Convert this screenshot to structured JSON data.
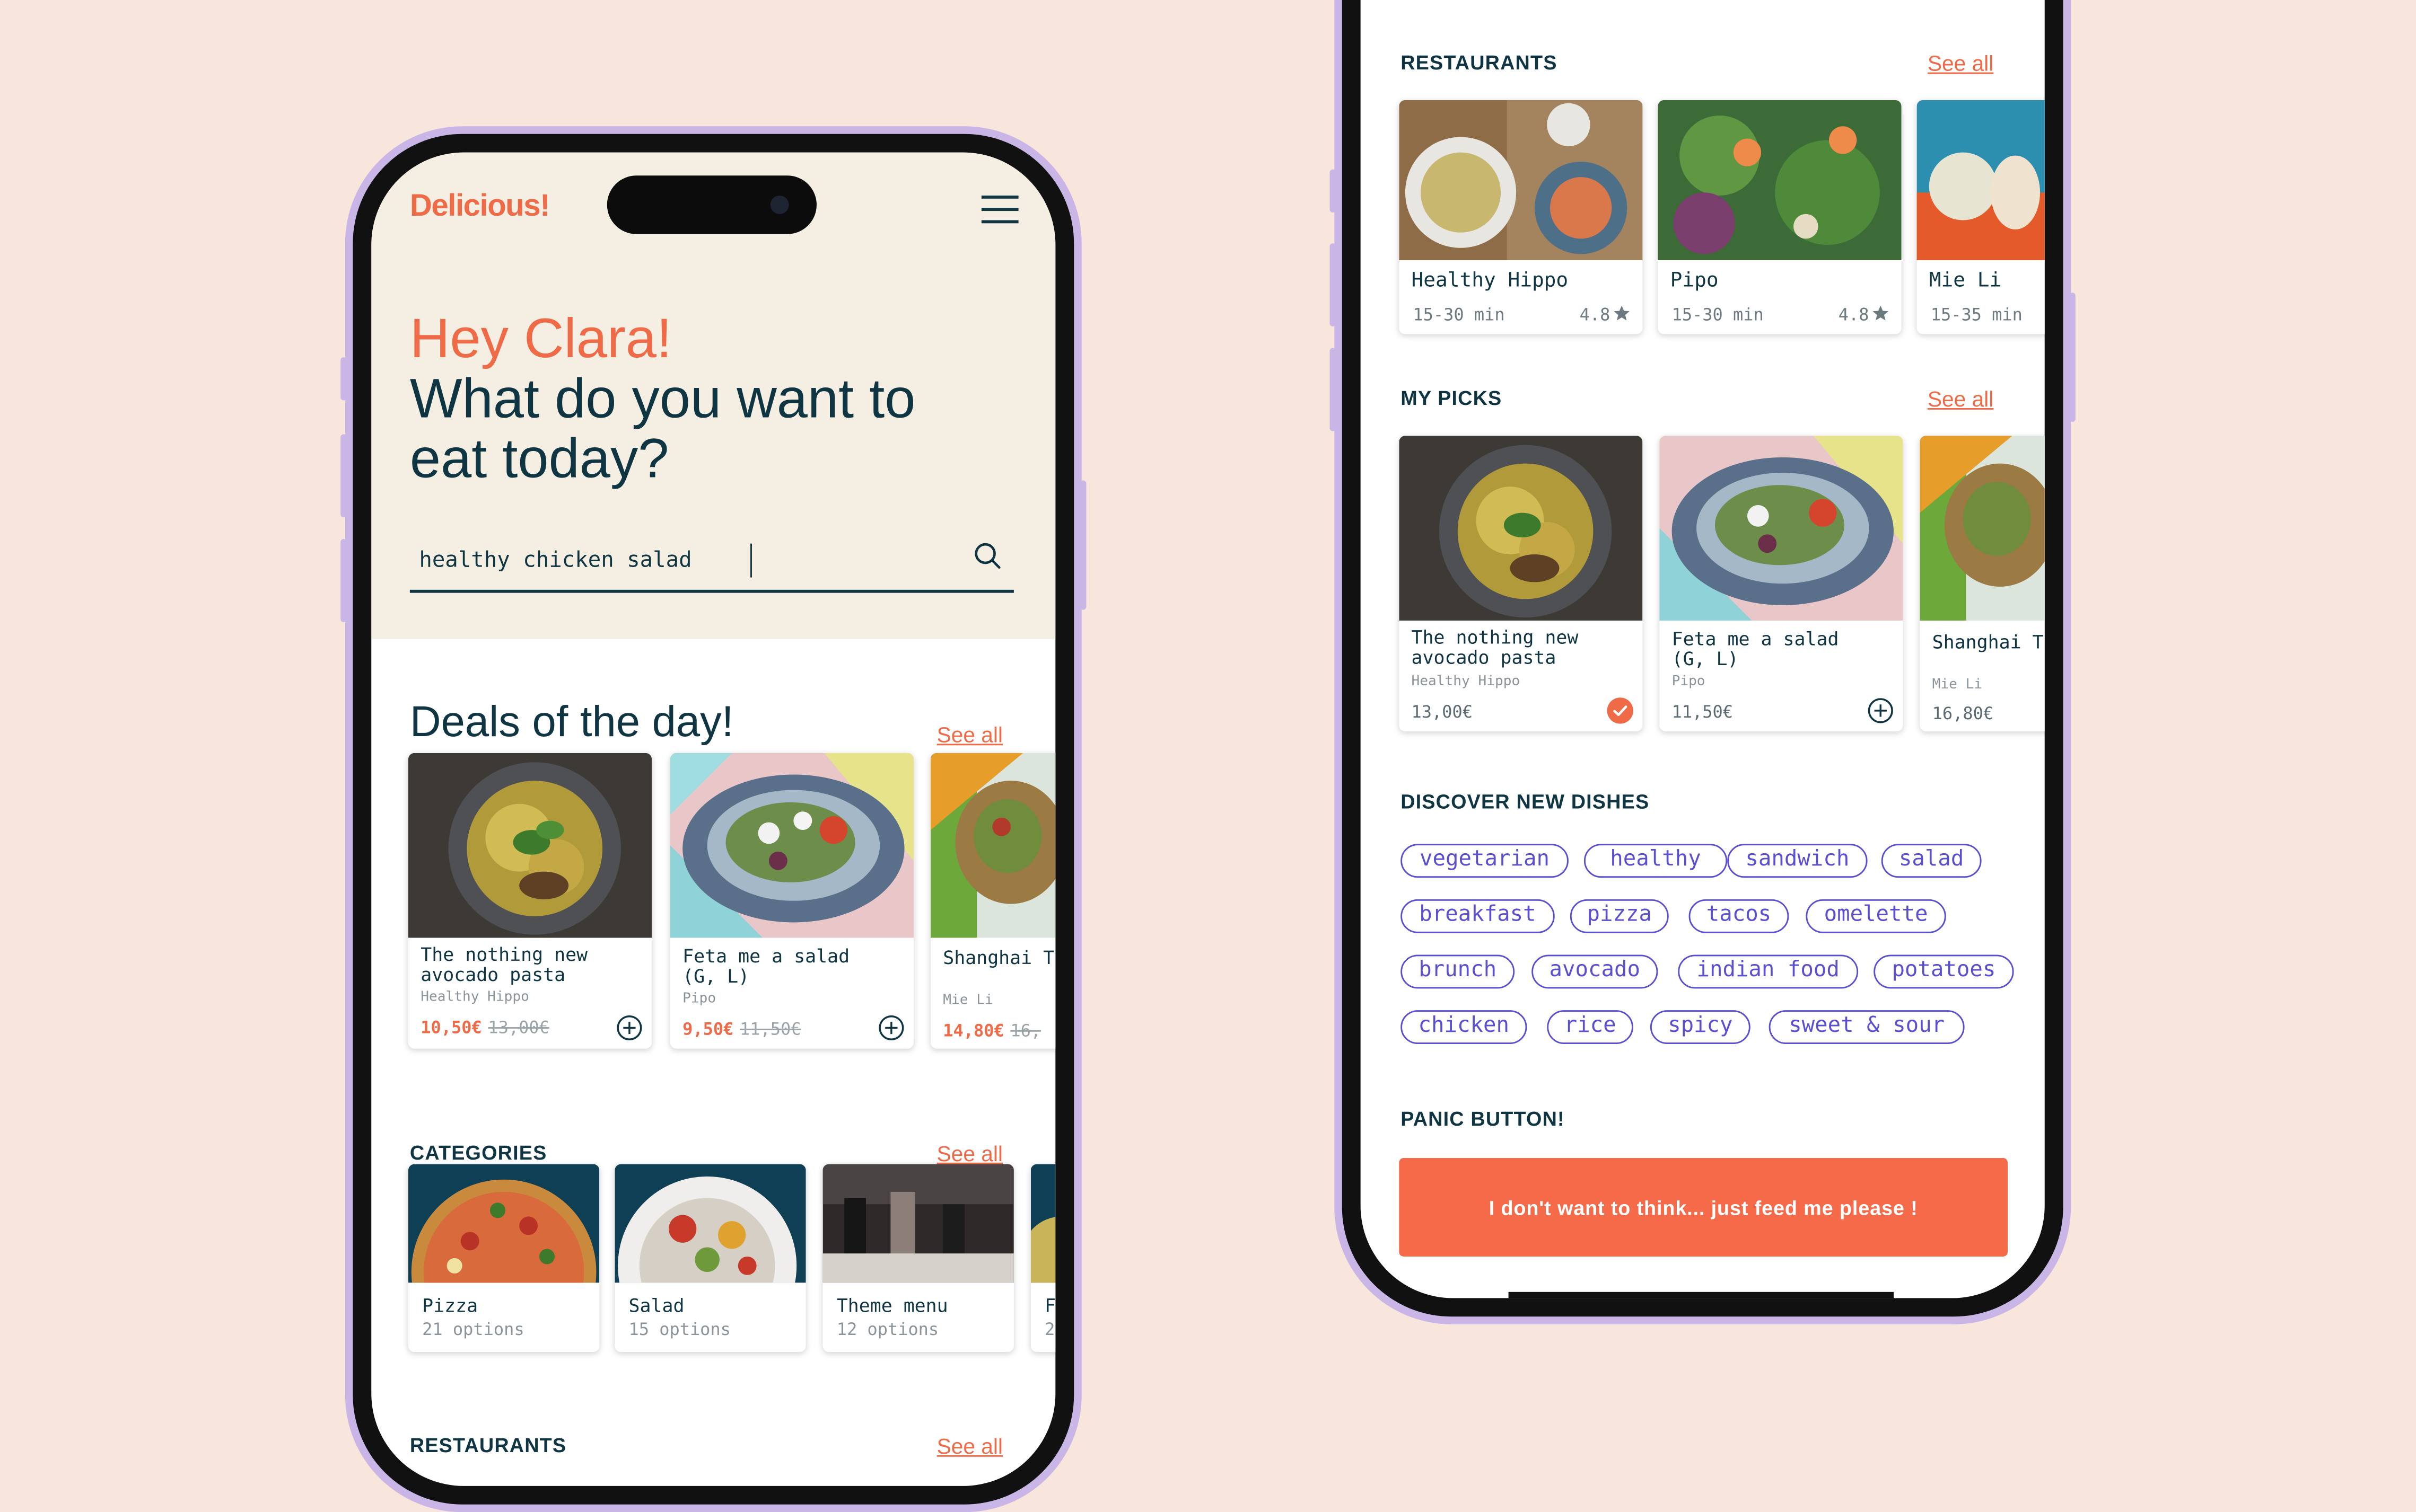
{
  "app": {
    "logo": "Delicious!",
    "greeting": "Hey Clara!",
    "question": "What do you want to eat today?",
    "search": {
      "value": "healthy chicken salad"
    },
    "icons": {
      "menu": "hamburger-menu-icon",
      "search": "search-icon",
      "add": "plus-circle-icon",
      "picked": "check-circle-icon",
      "rating": "star-icon"
    }
  },
  "colors": {
    "accent": "#ef6a47",
    "navy": "#0f3543",
    "cream": "#f4efe2",
    "tag": "#5b4fd1",
    "frame": "#c9b6e6",
    "background": "#f8e5dc"
  },
  "deals": {
    "title": "Deals of the day!",
    "see_all": "See all",
    "items": [
      {
        "name": "The nothing new\navocado pasta",
        "restaurant": "Healthy Hippo",
        "price": "10,50€",
        "old_price": "13,00€"
      },
      {
        "name": "Feta me a salad\n(G, L)",
        "restaurant": "Pipo",
        "price": "9,50€",
        "old_price": "11,50€"
      },
      {
        "name": "Shanghai T",
        "restaurant": "Mie Li",
        "price": "14,80€",
        "old_price": "16,"
      }
    ]
  },
  "categories": {
    "title": "CATEGORIES",
    "see_all": "See all",
    "items": [
      {
        "name": "Pizza",
        "count": "21 options"
      },
      {
        "name": "Salad",
        "count": "15 options"
      },
      {
        "name": "Theme menu",
        "count": "12 options"
      },
      {
        "name": "F",
        "count": "2"
      }
    ]
  },
  "restaurants_bottom": {
    "title": "RESTAURANTS",
    "see_all": "See all"
  },
  "restaurants": {
    "title": "RESTAURANTS",
    "see_all": "See all",
    "items": [
      {
        "name": "Healthy Hippo",
        "time": "15-30 min",
        "rating": "4.8"
      },
      {
        "name": "Pipo",
        "time": "15-30 min",
        "rating": "4.8"
      },
      {
        "name": "Mie Li",
        "time": "15-35 min",
        "rating": ""
      }
    ]
  },
  "picks": {
    "title": "MY PICKS",
    "see_all": "See all",
    "items": [
      {
        "name": "The nothing new\navocado pasta",
        "restaurant": "Healthy Hippo",
        "price": "13,00€"
      },
      {
        "name": "Feta me a salad\n(G, L)",
        "restaurant": "Pipo",
        "price": "11,50€"
      },
      {
        "name": "Shanghai T",
        "restaurant": "Mie Li",
        "price": "16,80€"
      }
    ]
  },
  "discover": {
    "title": "DISCOVER NEW DISHES",
    "tags": [
      "vegetarian",
      "healthy",
      "sandwich",
      "salad",
      "breakfast",
      "pizza",
      "tacos",
      "omelette",
      "brunch",
      "avocado",
      "indian food",
      "potatoes",
      "chicken",
      "rice",
      "spicy",
      "sweet & sour"
    ]
  },
  "panic": {
    "title": "PANIC BUTTON!",
    "button": "I don't want to think... just feed me please !"
  }
}
